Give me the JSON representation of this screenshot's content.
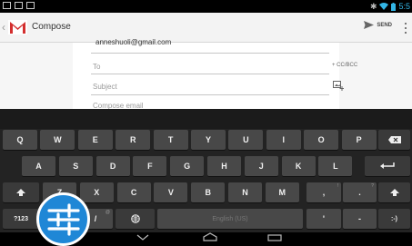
{
  "status_bar": {
    "time": "5:5"
  },
  "action_bar": {
    "title": "Compose",
    "send_label": "SEND"
  },
  "compose": {
    "from": "anneshuoli@gmail.com",
    "to_placeholder": "To",
    "cc_bcc_label": "+ CC/BCC",
    "subject_placeholder": "Subject",
    "body_placeholder": "Compose email"
  },
  "keyboard": {
    "row1": [
      {
        "label": "Q"
      },
      {
        "label": "W"
      },
      {
        "label": "E"
      },
      {
        "label": "R"
      },
      {
        "label": "T"
      },
      {
        "label": "Y"
      },
      {
        "label": "U"
      },
      {
        "label": "I"
      },
      {
        "label": "O"
      },
      {
        "label": "P"
      }
    ],
    "row2": [
      {
        "label": "A"
      },
      {
        "label": "S"
      },
      {
        "label": "D"
      },
      {
        "label": "F"
      },
      {
        "label": "G"
      },
      {
        "label": "H"
      },
      {
        "label": "J"
      },
      {
        "label": "K"
      },
      {
        "label": "L"
      }
    ],
    "row3": [
      {
        "label": "Z"
      },
      {
        "label": "X"
      },
      {
        "label": "C"
      },
      {
        "label": "V"
      },
      {
        "label": "B"
      },
      {
        "label": "N"
      },
      {
        "label": "M"
      }
    ],
    "comma": ",",
    "period": ".",
    "exclam_hint": "!",
    "question_hint": "?",
    "symbols_label": "?123",
    "slash": "/",
    "at_hint": "@",
    "space_label": "English (US)",
    "apostrophe": "'",
    "dash": "-",
    "emoji": ":-)"
  },
  "colors": {
    "accent": "#33b5e5",
    "fab": "#1f87d6",
    "key": "#484848",
    "keyboard_bg": "#232323"
  },
  "icons": [
    "status-icon",
    "wifi-icon",
    "battery-icon",
    "gmail-icon",
    "send-icon",
    "overflow-icon",
    "attach-icon",
    "backspace-icon",
    "enter-icon",
    "shift-icon",
    "globe-icon",
    "back-nav-icon",
    "home-nav-icon",
    "recents-nav-icon",
    "settings-sliders-icon"
  ]
}
